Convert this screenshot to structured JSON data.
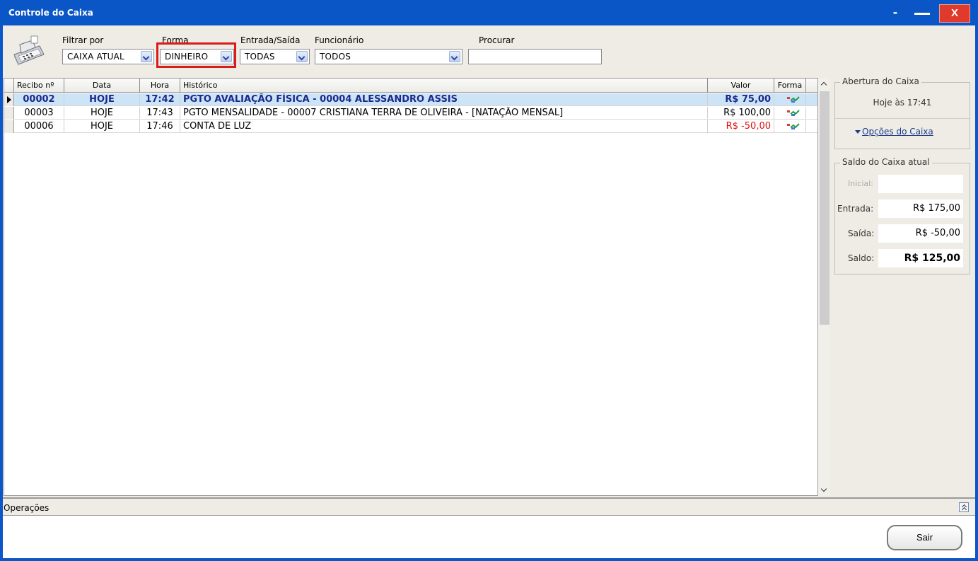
{
  "window": {
    "title": "Controle do Caixa",
    "min1": "-",
    "close": "X"
  },
  "filters": {
    "filtrar_por": {
      "label": "Filtrar por",
      "value": "CAIXA ATUAL"
    },
    "forma": {
      "label": "Forma",
      "value": "DINHEIRO"
    },
    "entrada_saida": {
      "label": "Entrada/Saída",
      "value": "TODAS"
    },
    "funcionario": {
      "label": "Funcionário",
      "value": "TODOS"
    },
    "procurar": {
      "label": "Procurar",
      "value": ""
    }
  },
  "table": {
    "headers": {
      "recibo": "Recibo nº",
      "data": "Data",
      "hora": "Hora",
      "historico": "Histórico",
      "valor": "Valor",
      "forma": "Forma"
    },
    "rows": [
      {
        "recibo": "00002",
        "data": "HOJE",
        "hora": "17:42",
        "historico": "PGTO AVALIAÇÃO FÍSICA - 00004 ALESSANDRO ASSIS",
        "valor": "R$ 75,00"
      },
      {
        "recibo": "00003",
        "data": "HOJE",
        "hora": "17:43",
        "historico": "PGTO MENSALIDADE - 00007 CRISTIANA TERRA DE OLIVEIRA - [NATAÇÃO MENSAL]",
        "valor": "R$ 100,00"
      },
      {
        "recibo": "00006",
        "data": "HOJE",
        "hora": "17:46",
        "historico": "CONTA DE LUZ",
        "valor": "R$ -50,00"
      }
    ]
  },
  "abertura": {
    "title": "Abertura do Caixa",
    "text": "Hoje às 17:41",
    "options_link": "Opções do Caixa"
  },
  "saldo": {
    "title": "Saldo do Caixa atual",
    "inicial_label": "Inicial:",
    "inicial_value": "",
    "entrada_label": "Entrada:",
    "entrada_value": "R$ 175,00",
    "saida_label": "Saída:",
    "saida_value": "R$ -50,00",
    "saldo_label": "Saldo:",
    "saldo_value": "R$ 125,00"
  },
  "operacoes": {
    "label": "Operações"
  },
  "sair_label": "Sair",
  "colors": {
    "titlebar": "#0a56c6",
    "selected_row": "#cde4f7",
    "negative": "#e01010",
    "highlight": "#d81c1c"
  }
}
